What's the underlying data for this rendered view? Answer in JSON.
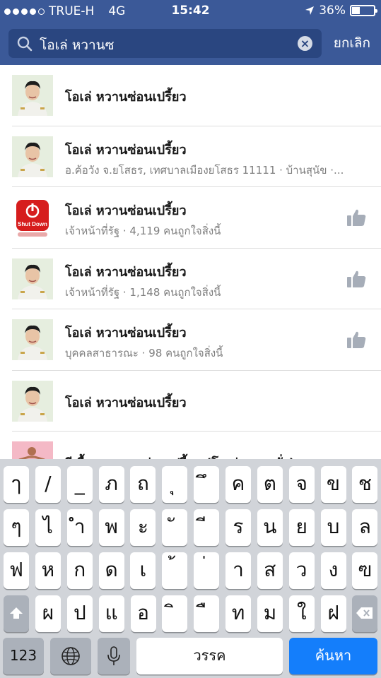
{
  "status_bar": {
    "carrier": "TRUE-H",
    "network": "4G",
    "time": "15:42",
    "battery": "36%",
    "battery_level": 0.36,
    "signal_bars_filled": 4,
    "signal_bars_total": 5
  },
  "search": {
    "query": "โอเล่ หวานซ",
    "cancel_label": "ยกเลิก"
  },
  "results": [
    {
      "title": "โอเล่ หวานซ่อนเปรี้ยว",
      "subtitle": "",
      "avatar": "person",
      "like": false
    },
    {
      "title": "โอเล่ หวานซ่อนเปรี้ยว",
      "subtitle": "อ.ค้อวัง จ.ยโสธร, เทศบาลเมืองยโสธร 11111 · บ้านสุนัข ·...",
      "avatar": "person",
      "like": false
    },
    {
      "title": "โอเล่ หวานซ่อนเปรี้ยว",
      "subtitle": "เจ้าหน้าที่รัฐ · 4,119 คนถูกใจสิ่งนี้",
      "avatar": "shutdown",
      "avatar_label": "Shut Down",
      "like": true
    },
    {
      "title": "โอเล่ หวานซ่อนเปรี้ยว",
      "subtitle": "เจ้าหน้าที่รัฐ · 1,148 คนถูกใจสิ่งนี้",
      "avatar": "person",
      "like": true
    },
    {
      "title": "โอเล่ หวานซ่อนเปรี้ยว",
      "subtitle": "บุคคลสาธารณะ · 98 คนถูกใจสิ่งนี้",
      "avatar": "person",
      "like": true
    },
    {
      "title": "โอเล่ หวานซ่อนเปรี้ยว",
      "subtitle": "",
      "avatar": "person",
      "like": false
    },
    {
      "title": "ผีเสื้อ... หวานซ่อนเปรี้ยว (โอเล่ หวานซั่ง)",
      "subtitle": "",
      "avatar": "photo",
      "like": false
    }
  ],
  "keyboard": {
    "row1": [
      "ๅ",
      "/",
      "_",
      "ภ",
      "ถ",
      "ุ",
      "ึ",
      "ค",
      "ต",
      "จ",
      "ข",
      "ช"
    ],
    "row2": [
      "ๆ",
      "ไ",
      "ำ",
      "พ",
      "ะ",
      "ั",
      "ี",
      "ร",
      "น",
      "ย",
      "บ",
      "ล"
    ],
    "row3": [
      "ฟ",
      "ห",
      "ก",
      "ด",
      "เ",
      "้",
      "่",
      "า",
      "ส",
      "ว",
      "ง",
      "ฃ"
    ],
    "row4": [
      "ผ",
      "ป",
      "แ",
      "อ",
      "ิ",
      "ื",
      "ท",
      "ม",
      "ใ",
      "ฝ"
    ],
    "numbers_label": "123",
    "space_label": "วรรค",
    "search_label": "ค้นหา",
    "shift_icon": "shift-icon",
    "delete_icon": "backspace-icon",
    "globe_icon": "globe-icon",
    "mic_icon": "microphone-icon"
  },
  "colors": {
    "header": "#3b5998",
    "search_field": "#2a4680",
    "keyboard_bg": "#d1d4d9",
    "search_key": "#147efb",
    "like_icon": "#a6adb8"
  }
}
